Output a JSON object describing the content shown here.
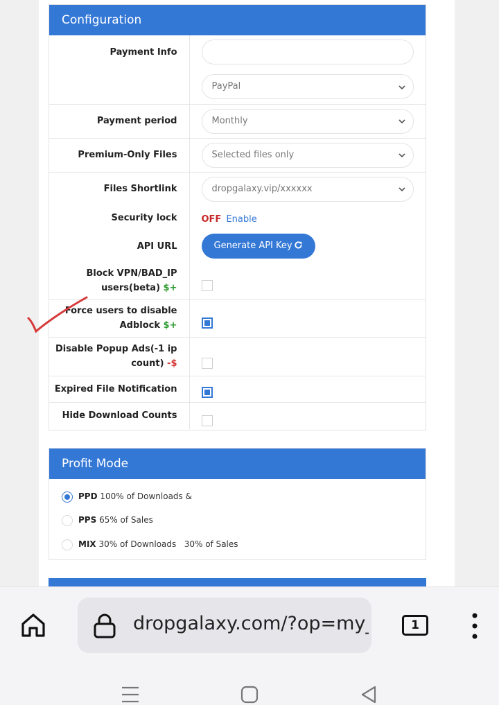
{
  "config": {
    "title": "Configuration",
    "payment_info_label": "Payment Info",
    "payment_info_value": "",
    "payment_method": "PayPal",
    "payment_period_label": "Payment period",
    "payment_period_value": "Monthly",
    "premium_only_label": "Premium-Only Files",
    "premium_only_value": "Selected files only",
    "shortlink_label": "Files Shortlink",
    "shortlink_value": "dropgalaxy.vip/xxxxxx",
    "security_lock_label": "Security lock",
    "security_lock_state": "OFF",
    "security_lock_action": "Enable",
    "api_url_label": "API URL",
    "api_button": "Generate API Key",
    "block_vpn_label_1": "Block VPN/BAD_IP",
    "block_vpn_label_2": "users(beta)",
    "block_vpn_badge": "$+",
    "force_adblock_label_1": "Force users to disable",
    "force_adblock_label_2": "Adblock",
    "force_adblock_badge": "$+",
    "disable_popup_label_1": "Disable Popup Ads(-1 ip",
    "disable_popup_label_2": "count)",
    "disable_popup_badge": "-$",
    "expired_label": "Expired File Notification",
    "hide_counts_label": "Hide Download Counts",
    "checks": {
      "block_vpn": false,
      "force_adblock": true,
      "disable_popup": false,
      "expired": true,
      "hide_counts": false
    }
  },
  "profit": {
    "title": "Profit Mode",
    "options": [
      {
        "code": "PPD",
        "text": "100% of Downloads &",
        "selected": true
      },
      {
        "code": "PPS",
        "text": "65% of Sales",
        "selected": false
      },
      {
        "code": "MIX",
        "text": "30% of Downloads   30% of Sales",
        "selected": false
      }
    ]
  },
  "browser": {
    "url": "dropgalaxy.com/?op=my_",
    "tab_count": "1"
  },
  "colors": {
    "accent": "#3478d6",
    "off": "#c62828",
    "positive": "#2e9b2e",
    "negative": "#d32f2f",
    "annotation": "#d63a3a"
  }
}
